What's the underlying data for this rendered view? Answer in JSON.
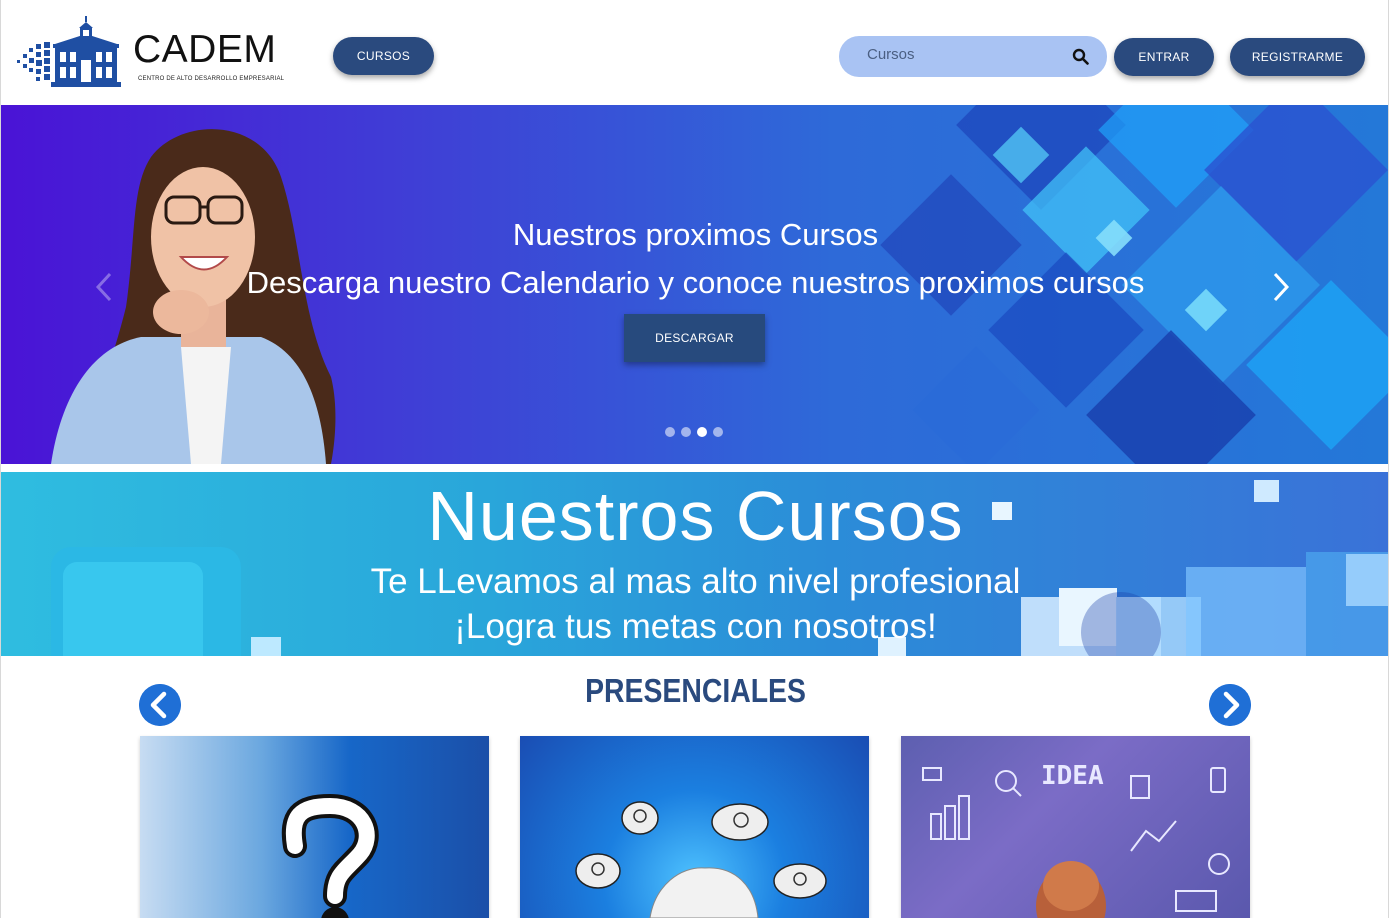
{
  "header": {
    "logo_text": "CADEM",
    "logo_subtitle": "CENTRO DE ALTO DESARROLLO EMPRESARIAL",
    "cursos_label": "CURSOS",
    "search_placeholder": "Cursos",
    "entrar_label": "ENTRAR",
    "registro_label": "REGISTRARME"
  },
  "hero": {
    "title": "Nuestros proximos Cursos",
    "subtitle": "Descarga nuestro Calendario y conoce nuestros proximos cursos",
    "button_label": "DESCARGAR",
    "slides_count": 4,
    "active_slide": 3
  },
  "banner": {
    "title": "Nuestros Cursos",
    "line1": "Te LLevamos al mas alto nivel profesional",
    "line2": "¡Logra tus metas con nosotros!"
  },
  "section": {
    "title": "PRESENCIALES",
    "card3_text": "IDEA"
  },
  "colors": {
    "brand": "#2a4a7e",
    "search_bg": "#a9c3f3",
    "nav_circle": "#1f6fd6"
  },
  "icons": [
    "search-icon",
    "chevron-left-icon",
    "chevron-right-icon",
    "arrow-left-circle-icon",
    "arrow-right-circle-icon"
  ]
}
